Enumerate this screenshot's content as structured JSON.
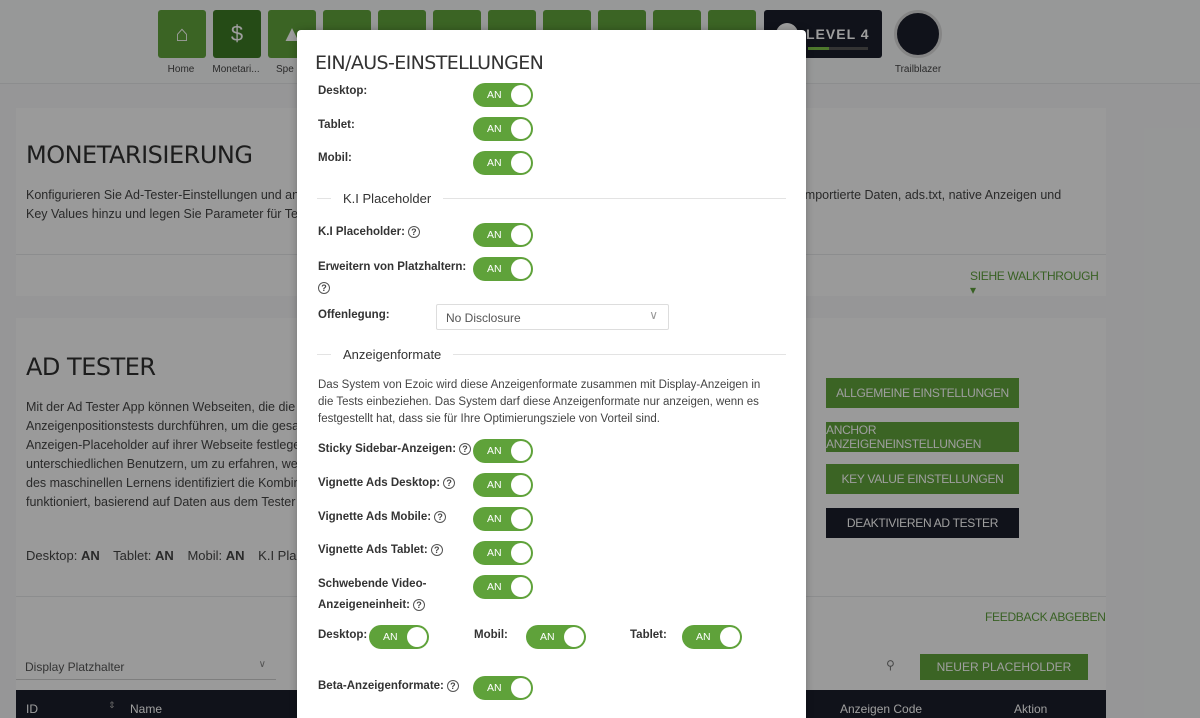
{
  "nav": {
    "tiles": [
      {
        "label": "Home",
        "icon": "home-icon"
      },
      {
        "label": "Monetari...",
        "icon": "dollar-icon"
      },
      {
        "label": "Spe",
        "icon": "speed-icon"
      },
      {
        "label": "",
        "icon": "app-icon"
      },
      {
        "label": "",
        "icon": "app-icon"
      },
      {
        "label": "",
        "icon": "app-icon"
      },
      {
        "label": "",
        "icon": "app-icon"
      },
      {
        "label": "",
        "icon": "app-icon"
      },
      {
        "label": "",
        "icon": "app-icon"
      },
      {
        "label": "",
        "icon": "app-icon"
      },
      {
        "label": "",
        "icon": "app-icon"
      }
    ],
    "level": "LEVEL 4",
    "level_progress": 0.35,
    "profile_label": "Trailblazer"
  },
  "monetization": {
    "title": "MONETARISIERUNG",
    "text_left": "Konfigurieren Sie Ad-Tester-Einstellungen und an",
    "text_right": "importierte Daten, ads.txt, native Anzeigen und",
    "text_line2": "Key Values hinzu und legen Sie Parameter für Test",
    "walkthrough": "SIEHE WALKTHROUGH"
  },
  "ad_tester": {
    "title": "AD TESTER",
    "lines": [
      "Mit der Ad Tester App können Webseiten, die die",
      "Anzeigenpositionstests durchführen, um die gesa",
      "Anzeigen-Placeholder auf ihrer Webseite festlege",
      "unterschiedlichen Benutzern, um zu erfahren, we",
      "des maschinellen Lernens identifiziert die Kombir",
      "funktioniert, basierend auf Daten aus dem Tester"
    ],
    "status": {
      "desktop_label": "Desktop:",
      "desktop_value": "AN",
      "tablet_label": "Tablet:",
      "tablet_value": "AN",
      "mobile_label": "Mobil:",
      "mobile_value": "AN",
      "ki_label": "K.I Place"
    },
    "buttons": {
      "general": "ALLGEMEINE EINSTELLUNGEN",
      "anchor": "ANCHOR ANZEIGENEINSTELLUNGEN",
      "key_value": "KEY VALUE EINSTELLUNGEN",
      "deactivate": "DEAKTIVIEREN AD TESTER"
    },
    "feedback": "FEEDBACK ABGEBEN",
    "filter_select": "Display Platzhalter",
    "new_placeholder": "NEUER PLACEHOLDER",
    "table_headers": {
      "id": "ID",
      "name": "Name",
      "code": "Anzeigen Code",
      "action": "Aktion"
    }
  },
  "modal": {
    "title": "EIN/AUS-EINSTELLUNGEN",
    "toggle_text": "AN",
    "device_rows": [
      {
        "label": "Desktop:"
      },
      {
        "label": "Tablet:"
      },
      {
        "label": "Mobil:"
      }
    ],
    "section_ki": "K.I Placeholder",
    "ki_placeholder_label": "K.I Placeholder:",
    "extend_label": "Erweitern von Platzhaltern:",
    "disclosure_label": "Offenlegung:",
    "disclosure_value": "No Disclosure",
    "section_formats": "Anzeigenformate",
    "formats_desc": "Das System von Ezoic wird diese Anzeigenformate zusammen mit Display-Anzeigen in die Tests einbeziehen. Das System darf diese Anzeigenformate nur anzeigen, wenn es festgestellt hat, dass sie für Ihre Optimierungsziele von Vorteil sind.",
    "format_rows": [
      {
        "label": "Sticky Sidebar-Anzeigen:"
      },
      {
        "label": "Vignette Ads Desktop:"
      },
      {
        "label": "Vignette Ads Mobile:"
      },
      {
        "label": "Vignette Ads Tablet:"
      }
    ],
    "floating_video_label_1": "Schwebende Video-",
    "floating_video_label_2": "Anzeigeneinheit:",
    "sub_desktop": "Desktop:",
    "sub_mobile": "Mobil:",
    "sub_tablet": "Tablet:",
    "beta_label": "Beta-Anzeigenformate:"
  },
  "colors": {
    "accent": "#5fa23a",
    "dark": "#1b1d2a"
  }
}
